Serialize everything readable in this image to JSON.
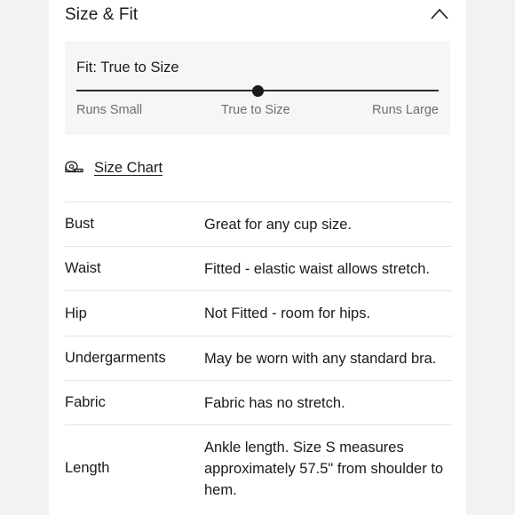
{
  "section": {
    "title": "Size & Fit",
    "toggle_icon": "chevron-up-icon"
  },
  "fit": {
    "label": "Fit: True to Size",
    "scale": [
      "Runs Small",
      "True to Size",
      "Runs Large"
    ],
    "position": 0.5
  },
  "size_chart": {
    "label": "Size Chart",
    "icon": "measuring-tape-icon"
  },
  "details": [
    {
      "label": "Bust",
      "value": "Great for any cup size."
    },
    {
      "label": "Waist",
      "value": "Fitted - elastic waist allows stretch."
    },
    {
      "label": "Hip",
      "value": "Not Fitted - room for hips."
    },
    {
      "label": "Undergarments",
      "value": "May be worn with any standard bra."
    },
    {
      "label": "Fabric",
      "value": "Fabric has no stretch."
    },
    {
      "label": "Length",
      "value": "Ankle length. Size S measures approximately 57.5\" from shoulder to hem."
    }
  ],
  "colors": {
    "text": "#1a1a1a",
    "muted": "#6e6e6e",
    "panel": "#f6f6f6",
    "divider": "#e3e3e3"
  }
}
